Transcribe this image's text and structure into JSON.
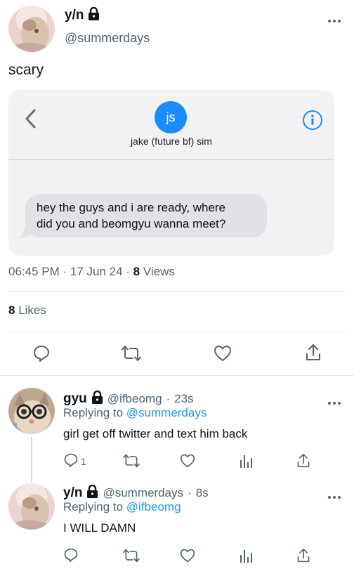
{
  "main_tweet": {
    "display_name": "y/n",
    "handle": "@summerdays",
    "text": "scary",
    "more_icon": "more-icon",
    "timestamp": "06:45 PM · 17 Jun 24 · ",
    "views_count": "8",
    "views_label": " Views",
    "likes_count": "8",
    "likes_label": " Likes"
  },
  "imessage": {
    "contact_initials": "js",
    "contact_name": "jake (future bf) sim",
    "message_line1": "hey the guys and i are ready, where",
    "message_line2": "did you and beomgyu wanna meet?"
  },
  "replies": [
    {
      "display_name": "gyu",
      "handle": "@ifbeomg",
      "time": "23s",
      "replying_prefix": "Replying to ",
      "replying_to": "@summerdays",
      "text": "girl get off twitter and text him back",
      "reply_count": "1"
    },
    {
      "display_name": "y/n",
      "handle": "@summerdays",
      "time": "8s",
      "replying_prefix": "Replying to ",
      "replying_to": "@ifbeomg",
      "text": "I WILL DAMN",
      "reply_count": ""
    }
  ],
  "colors": {
    "accent": "#1d9bf0",
    "secondary_text": "#536471",
    "imessage_blue": "#1a8cff",
    "bubble_gray": "#e2e2e6"
  }
}
